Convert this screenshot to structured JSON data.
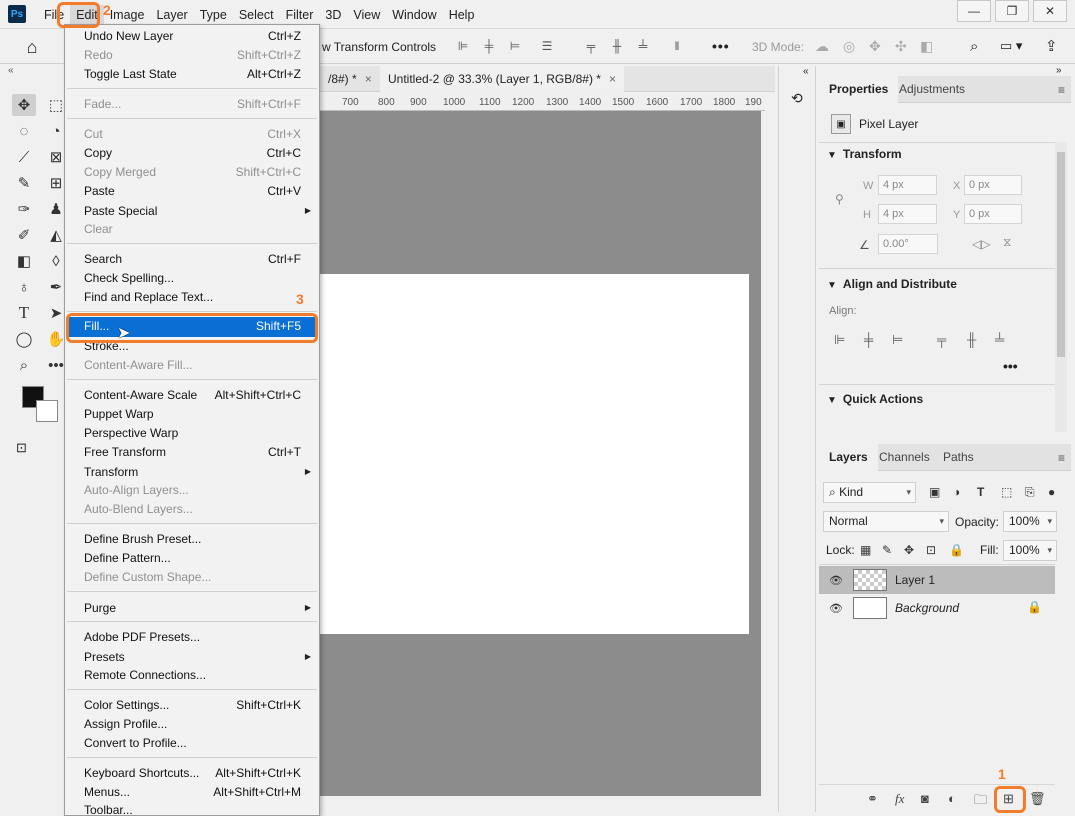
{
  "app": {
    "logo": "Ps",
    "menu": [
      "File",
      "Edit",
      "Image",
      "Layer",
      "Type",
      "Select",
      "Filter",
      "3D",
      "View",
      "Window",
      "Help"
    ],
    "window_controls": [
      "—",
      "❐",
      "✕"
    ]
  },
  "options_bar": {
    "transform_controls_label": "w Transform Controls",
    "more": "•••",
    "mode_3d_label": "3D Mode:"
  },
  "tabs": [
    {
      "label": "/8#) *"
    },
    {
      "label": "Untitled-2 @ 33.3% (Layer 1, RGB/8#) *"
    }
  ],
  "ruler": {
    "ticks": [
      "700",
      "800",
      "900",
      "1000",
      "1100",
      "1200",
      "1300",
      "1400",
      "1500",
      "1600",
      "1700",
      "1800",
      "190"
    ]
  },
  "edit_menu": {
    "items": [
      {
        "label": "Undo New Layer",
        "shortcut": "Ctrl+Z",
        "disabled": false
      },
      {
        "label": "Redo",
        "shortcut": "Shift+Ctrl+Z",
        "disabled": true
      },
      {
        "label": "Toggle Last State",
        "shortcut": "Alt+Ctrl+Z",
        "disabled": false
      },
      {
        "label": "Fade...",
        "shortcut": "Shift+Ctrl+F",
        "disabled": true
      },
      {
        "label": "Cut",
        "shortcut": "Ctrl+X",
        "disabled": true
      },
      {
        "label": "Copy",
        "shortcut": "Ctrl+C",
        "disabled": false
      },
      {
        "label": "Copy Merged",
        "shortcut": "Shift+Ctrl+C",
        "disabled": true
      },
      {
        "label": "Paste",
        "shortcut": "Ctrl+V",
        "disabled": false
      },
      {
        "label": "Paste Special",
        "shortcut": "",
        "disabled": false,
        "submenu": true
      },
      {
        "label": "Clear",
        "shortcut": "",
        "disabled": true
      },
      {
        "label": "Search",
        "shortcut": "Ctrl+F",
        "disabled": false
      },
      {
        "label": "Check Spelling...",
        "shortcut": "",
        "disabled": false
      },
      {
        "label": "Find and Replace Text...",
        "shortcut": "",
        "disabled": false
      },
      {
        "label": "Fill...",
        "shortcut": "Shift+F5",
        "disabled": false,
        "highlighted": true
      },
      {
        "label": "Stroke...",
        "shortcut": "",
        "disabled": false
      },
      {
        "label": "Content-Aware Fill...",
        "shortcut": "",
        "disabled": true
      },
      {
        "label": "Content-Aware Scale",
        "shortcut": "Alt+Shift+Ctrl+C",
        "disabled": false
      },
      {
        "label": "Puppet Warp",
        "shortcut": "",
        "disabled": false
      },
      {
        "label": "Perspective Warp",
        "shortcut": "",
        "disabled": false
      },
      {
        "label": "Free Transform",
        "shortcut": "Ctrl+T",
        "disabled": false
      },
      {
        "label": "Transform",
        "shortcut": "",
        "disabled": false,
        "submenu": true
      },
      {
        "label": "Auto-Align Layers...",
        "shortcut": "",
        "disabled": true
      },
      {
        "label": "Auto-Blend Layers...",
        "shortcut": "",
        "disabled": true
      },
      {
        "label": "Define Brush Preset...",
        "shortcut": "",
        "disabled": false
      },
      {
        "label": "Define Pattern...",
        "shortcut": "",
        "disabled": false
      },
      {
        "label": "Define Custom Shape...",
        "shortcut": "",
        "disabled": true
      },
      {
        "label": "Purge",
        "shortcut": "",
        "disabled": false,
        "submenu": true
      },
      {
        "label": "Adobe PDF Presets...",
        "shortcut": "",
        "disabled": false
      },
      {
        "label": "Presets",
        "shortcut": "",
        "disabled": false,
        "submenu": true
      },
      {
        "label": "Remote Connections...",
        "shortcut": "",
        "disabled": false
      },
      {
        "label": "Color Settings...",
        "shortcut": "Shift+Ctrl+K",
        "disabled": false
      },
      {
        "label": "Assign Profile...",
        "shortcut": "",
        "disabled": false
      },
      {
        "label": "Convert to Profile...",
        "shortcut": "",
        "disabled": false
      },
      {
        "label": "Keyboard Shortcuts...",
        "shortcut": "Alt+Shift+Ctrl+K",
        "disabled": false
      },
      {
        "label": "Menus...",
        "shortcut": "Alt+Shift+Ctrl+M",
        "disabled": false
      },
      {
        "label": "Toolbar...",
        "shortcut": "",
        "disabled": false
      }
    ]
  },
  "properties_panel": {
    "tabs": [
      "Properties",
      "Adjustments"
    ],
    "layer_type": "Pixel Layer",
    "transform": {
      "title": "Transform",
      "w_label": "W",
      "w_value": "4 px",
      "h_label": "H",
      "h_value": "4 px",
      "x_label": "X",
      "x_value": "0 px",
      "y_label": "Y",
      "y_value": "0 px",
      "angle_value": "0.00°"
    },
    "align": {
      "title": "Align and Distribute",
      "label": "Align:"
    },
    "quick_actions": {
      "title": "Quick Actions"
    }
  },
  "layers_panel": {
    "tabs": [
      "Layers",
      "Channels",
      "Paths"
    ],
    "filter_kind": "Kind",
    "blend_mode": "Normal",
    "opacity_label": "Opacity:",
    "opacity_value": "100%",
    "lock_label": "Lock:",
    "fill_label": "Fill:",
    "fill_value": "100%",
    "layers": [
      {
        "name": "Layer 1",
        "selected": true
      },
      {
        "name": "Background",
        "selected": false,
        "locked": true
      }
    ]
  },
  "annotations": {
    "step1": "1",
    "step2": "2",
    "step3": "3"
  },
  "colors": {
    "accent": "#f07c2c",
    "highlight": "#0a6fd4",
    "canvas_bg": "#8c8c8c"
  }
}
